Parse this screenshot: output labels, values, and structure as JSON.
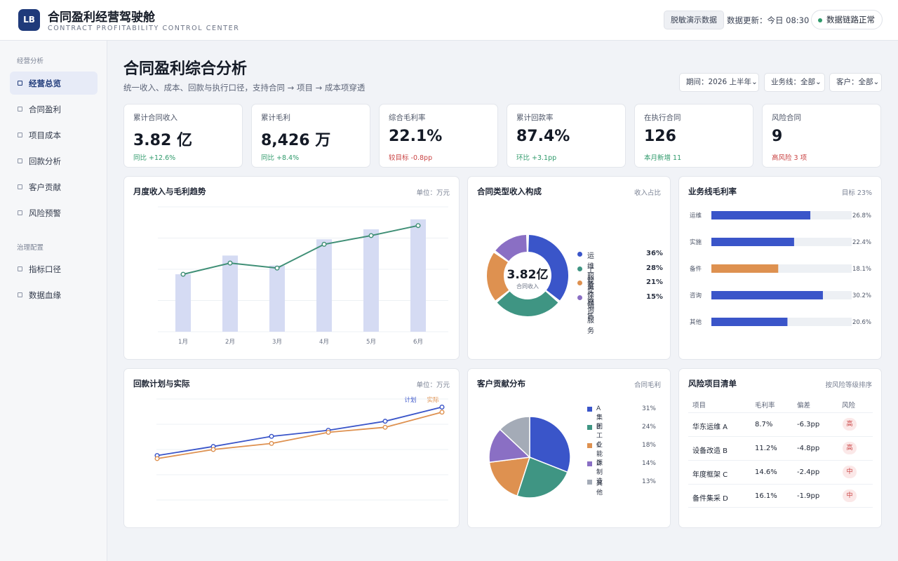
{
  "header": {
    "logo_text": "LB",
    "title": "合同盈利经营驾驶舱",
    "subtitle": "CONTRACT PROFITABILITY CONTROL CENTER",
    "demo_tag": "脱敏演示数据",
    "update_time": "数据更新：今日 08:30",
    "status": "数据链路正常",
    "status_color": "#2f9a6b"
  },
  "sidebar": {
    "group1": "经营分析",
    "items1": [
      {
        "label": "经营总览",
        "active": true
      },
      {
        "label": "合同盈利"
      },
      {
        "label": "项目成本"
      },
      {
        "label": "回款分析"
      },
      {
        "label": "客户贡献"
      },
      {
        "label": "风险预警"
      }
    ],
    "group2": "治理配置",
    "items2": [
      {
        "label": "指标口径"
      },
      {
        "label": "数据血缘"
      }
    ]
  },
  "page": {
    "title": "合同盈利综合分析",
    "subtitle": "统一收入、成本、回款与执行口径，支持合同 → 项目 → 成本项穿透",
    "filters": [
      "期间：2026 上半年⌄",
      "业务线：全部⌄",
      "客户：全部⌄"
    ]
  },
  "kpis": [
    {
      "label": "累计合同收入",
      "value": "3.82 亿",
      "delta": "同比 +12.6%",
      "trend": "up"
    },
    {
      "label": "累计毛利",
      "value": "8,426 万",
      "delta": "同比 +8.4%",
      "trend": "up"
    },
    {
      "label": "综合毛利率",
      "value": "22.1%",
      "delta": "较目标 -0.8pp",
      "trend": "down"
    },
    {
      "label": "累计回款率",
      "value": "87.4%",
      "delta": "环比 +3.1pp",
      "trend": "up"
    },
    {
      "label": "在执行合同",
      "value": "126",
      "delta": "本月新增 11",
      "trend": "up"
    },
    {
      "label": "风险合同",
      "value": "9",
      "delta": "高风险 3 项",
      "trend": "down"
    }
  ],
  "cards": {
    "monthly": {
      "title": "月度收入与毛利趋势",
      "note": "单位：万元"
    },
    "composition": {
      "title": "合同类型收入构成",
      "note": "收入占比"
    },
    "bizline": {
      "title": "业务线毛利率",
      "note": "目标 23%"
    },
    "collection": {
      "title": "回款计划与实际",
      "note": "单位：万元"
    },
    "customer": {
      "title": "客户贡献分布",
      "note": "合同毛利"
    },
    "risk": {
      "title": "风险项目清单",
      "note": "按风险等级排序"
    }
  },
  "chart_data": [
    {
      "type": "bar",
      "title": "月度收入与毛利趋势",
      "categories": [
        "1月",
        "2月",
        "3月",
        "4月",
        "5月",
        "6月"
      ],
      "ylim": [
        0,
        100
      ],
      "series": [
        {
          "kind": "bar",
          "values": [
            46,
            61,
            53,
            74,
            82,
            90
          ]
        },
        {
          "kind": "line",
          "values": [
            46,
            55,
            51,
            70,
            77,
            85
          ]
        }
      ],
      "colors": {
        "bar": "#d5dbf3",
        "line": "#3f8f76"
      }
    },
    {
      "type": "pie",
      "title": "合同类型收入构成",
      "center_value": "3.82亿",
      "center_label": "合同收入",
      "labels": [
        "运维服务",
        "工程实施",
        "备件销售",
        "咨询服务"
      ],
      "values": [
        36,
        28,
        21,
        15
      ],
      "value_labels": [
        "36%",
        "28%",
        "21%",
        "15%"
      ],
      "colors": [
        "#3a55c9",
        "#3f9583",
        "#de9150",
        "#8a6fc4"
      ]
    },
    {
      "type": "bar",
      "title": "业务线毛利率",
      "categories": [
        "运维",
        "实施",
        "备件",
        "咨询",
        "其他"
      ],
      "values": [
        26.8,
        22.4,
        18.1,
        30.2,
        20.6
      ],
      "value_labels": [
        "26.8%",
        "22.4%",
        "18.1%",
        "30.2%",
        "20.6%"
      ],
      "xlim": [
        0,
        38
      ],
      "colors": [
        "#3a55c9",
        "#3a55c9",
        "#de9150",
        "#3a55c9",
        "#3a55c9"
      ]
    },
    {
      "type": "line",
      "title": "回款计划与实际",
      "x": [
        1,
        2,
        3,
        4,
        5,
        6,
        7
      ],
      "ylim": [
        0,
        100
      ],
      "series": [
        {
          "name": "计划",
          "values": [
            44,
            53,
            63,
            69,
            78,
            92
          ],
          "color": "#3a55c9"
        },
        {
          "name": "实际",
          "values": [
            41,
            50,
            56,
            67,
            72,
            87
          ],
          "color": "#de9150"
        }
      ]
    },
    {
      "type": "pie",
      "title": "客户贡献分布",
      "labels": [
        "A集团",
        "B工业",
        "C能源",
        "D制造",
        "其他"
      ],
      "values": [
        31,
        24,
        18,
        14,
        13
      ],
      "value_labels": [
        "31%",
        "24%",
        "18%",
        "14%",
        "13%"
      ],
      "colors": [
        "#3a55c9",
        "#3f9583",
        "#de9150",
        "#8a6fc4",
        "#a4abb7"
      ]
    }
  ],
  "risk_table": {
    "headers": [
      "项目",
      "毛利率",
      "偏差",
      "风险"
    ],
    "rows": [
      [
        "华东运维 A",
        "8.7%",
        "-6.3pp",
        "高"
      ],
      [
        "设备改造 B",
        "11.2%",
        "-4.8pp",
        "高"
      ],
      [
        "年度框架 C",
        "14.6%",
        "-2.4pp",
        "中"
      ],
      [
        "备件集采 D",
        "16.1%",
        "-1.9pp",
        "中"
      ]
    ]
  }
}
